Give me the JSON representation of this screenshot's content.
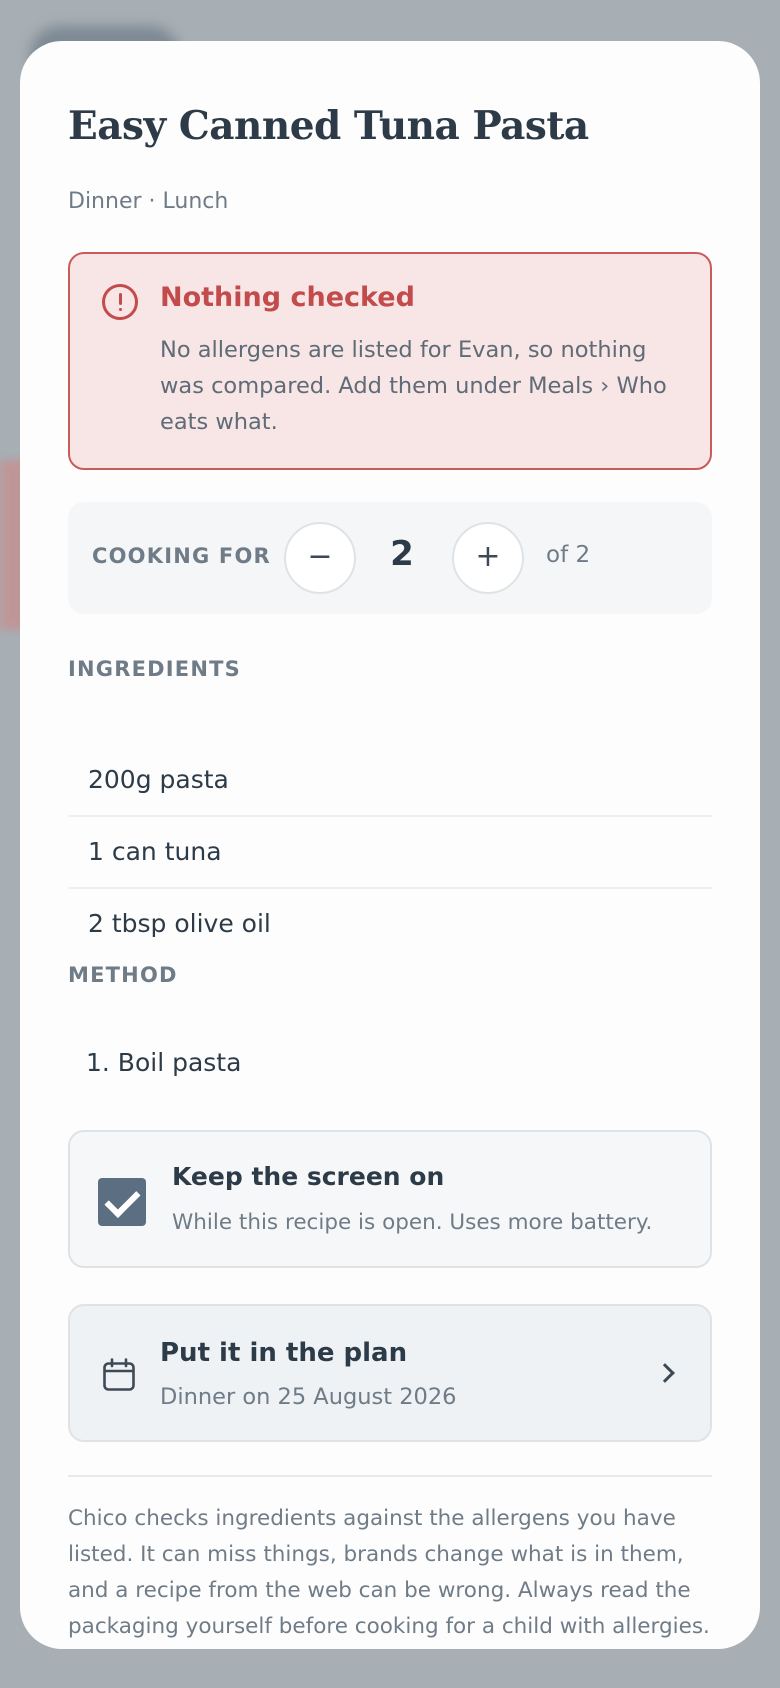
{
  "recipe": {
    "title": "Easy Canned Tuna Pasta",
    "categories": "Dinner · Lunch"
  },
  "alert": {
    "icon": "alert-circle-icon",
    "title": "Nothing checked",
    "body": "No allergens are listed for Evan, so nothing was compared. Add them under Meals › Who eats what.",
    "color": "#c24b4b"
  },
  "servings": {
    "label": "COOKING FOR",
    "minus": "−",
    "plus": "+",
    "value": "2",
    "of": "of 2"
  },
  "ingredients": {
    "label": "INGREDIENTS",
    "items": [
      "200g pasta",
      "1 can tuna",
      "2 tbsp olive oil"
    ]
  },
  "method": {
    "label": "METHOD",
    "steps": [
      "1. Boil pasta"
    ]
  },
  "keep_screen": {
    "checked": true,
    "title": "Keep the screen on",
    "subtitle": "While this recipe is open. Uses more battery."
  },
  "plan": {
    "icon": "calendar-icon",
    "title": "Put it in the plan",
    "subtitle": "Dinner on 25 August 2026"
  },
  "disclaimer": "Chico checks ingredients against the allergens you have listed. It can miss things, brands change what is in them, and a recipe from the web can be wrong. Always read the packaging yourself before cooking for a child with allergies."
}
